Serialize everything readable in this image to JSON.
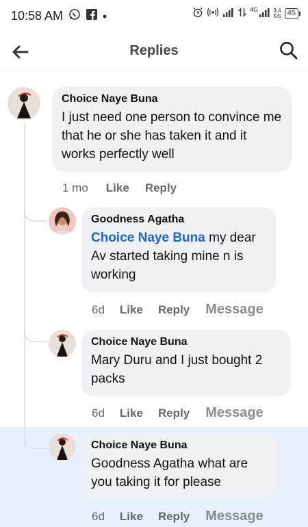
{
  "status_bar": {
    "time": "10:58 AM",
    "network": "4G",
    "speed_value": "3.4",
    "speed_unit": "K/s",
    "battery": "45"
  },
  "header": {
    "title": "Replies",
    "back_icon": "arrow-left-icon",
    "search_icon": "search-icon"
  },
  "comments": [
    {
      "author": "Choice Naye Buna",
      "text": "I just need one person to convince me that he or she has taken it and it works perfectly well",
      "time": "1 mo",
      "like": "Like",
      "reply": "Reply"
    },
    {
      "author": "Goodness Agatha",
      "mention": "Choice Naye Buna",
      "text": " my dear Av started taking mine n is working",
      "time": "6d",
      "like": "Like",
      "reply": "Reply",
      "message": "Message"
    },
    {
      "author": "Choice Naye Buna",
      "text": "Mary Duru and I just bought 2 packs",
      "time": "6d",
      "like": "Like",
      "reply": "Reply",
      "message": "Message"
    },
    {
      "author": "Choice Naye Buna",
      "text": "Goodness Agatha what are you taking it for please",
      "time": "6d",
      "like": "Like",
      "reply": "Reply",
      "message": "Message"
    }
  ],
  "colors": {
    "mention": "#1a64d6",
    "bubble": "#eff1f4",
    "highlight": "#e7f0fd"
  }
}
